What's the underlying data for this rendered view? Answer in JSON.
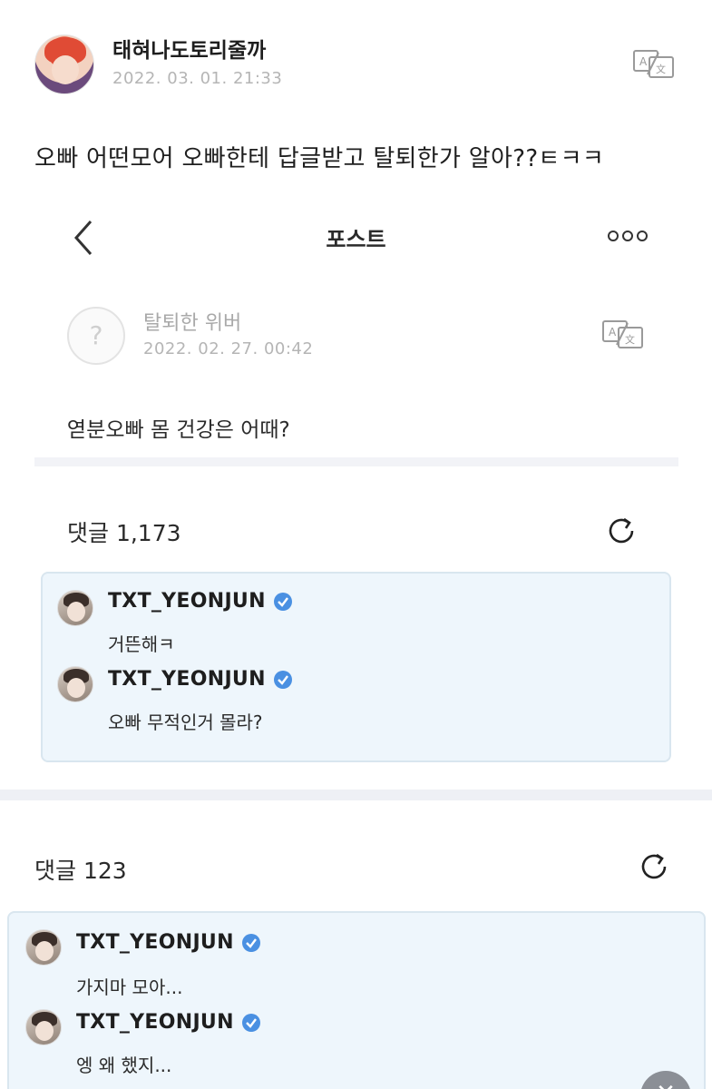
{
  "header": {
    "author": "태혀나도토리줄까",
    "date": "2022. 03. 01. 21:33"
  },
  "post": {
    "text": "오빠 어떤모어 오빠한테 답글받고 탈퇴한가 알아??ㅌㅋㅋ"
  },
  "embedded": {
    "title": "포스트",
    "deleted_avatar_glyph": "?",
    "deleted_user": "탈퇴한 위버",
    "deleted_date": "2022. 02. 27. 00:42",
    "post_text": "엳분오빠 몸 건강은 어때?",
    "comments_label": "댓글 1,173",
    "replies": [
      {
        "name": "TXT_YEONJUN",
        "text": "거뜬해ㅋ"
      },
      {
        "name": "TXT_YEONJUN",
        "text": "오빠 무적인거 몰라?"
      }
    ]
  },
  "second": {
    "comments_label": "댓글 123",
    "replies": [
      {
        "name": "TXT_YEONJUN",
        "text": "가지마 모아..."
      },
      {
        "name": "TXT_YEONJUN",
        "text": "엥 왜 했지..."
      }
    ]
  },
  "colors": {
    "verified": "#4a90e2",
    "box_bg": "#eef6fc",
    "box_border": "#d9e6ef"
  },
  "icons": {
    "translate": "translate-icon",
    "back": "chevron-left-icon",
    "more": "more-icon",
    "refresh": "refresh-icon",
    "verified": "verified-badge-icon",
    "fab": "close-icon"
  }
}
